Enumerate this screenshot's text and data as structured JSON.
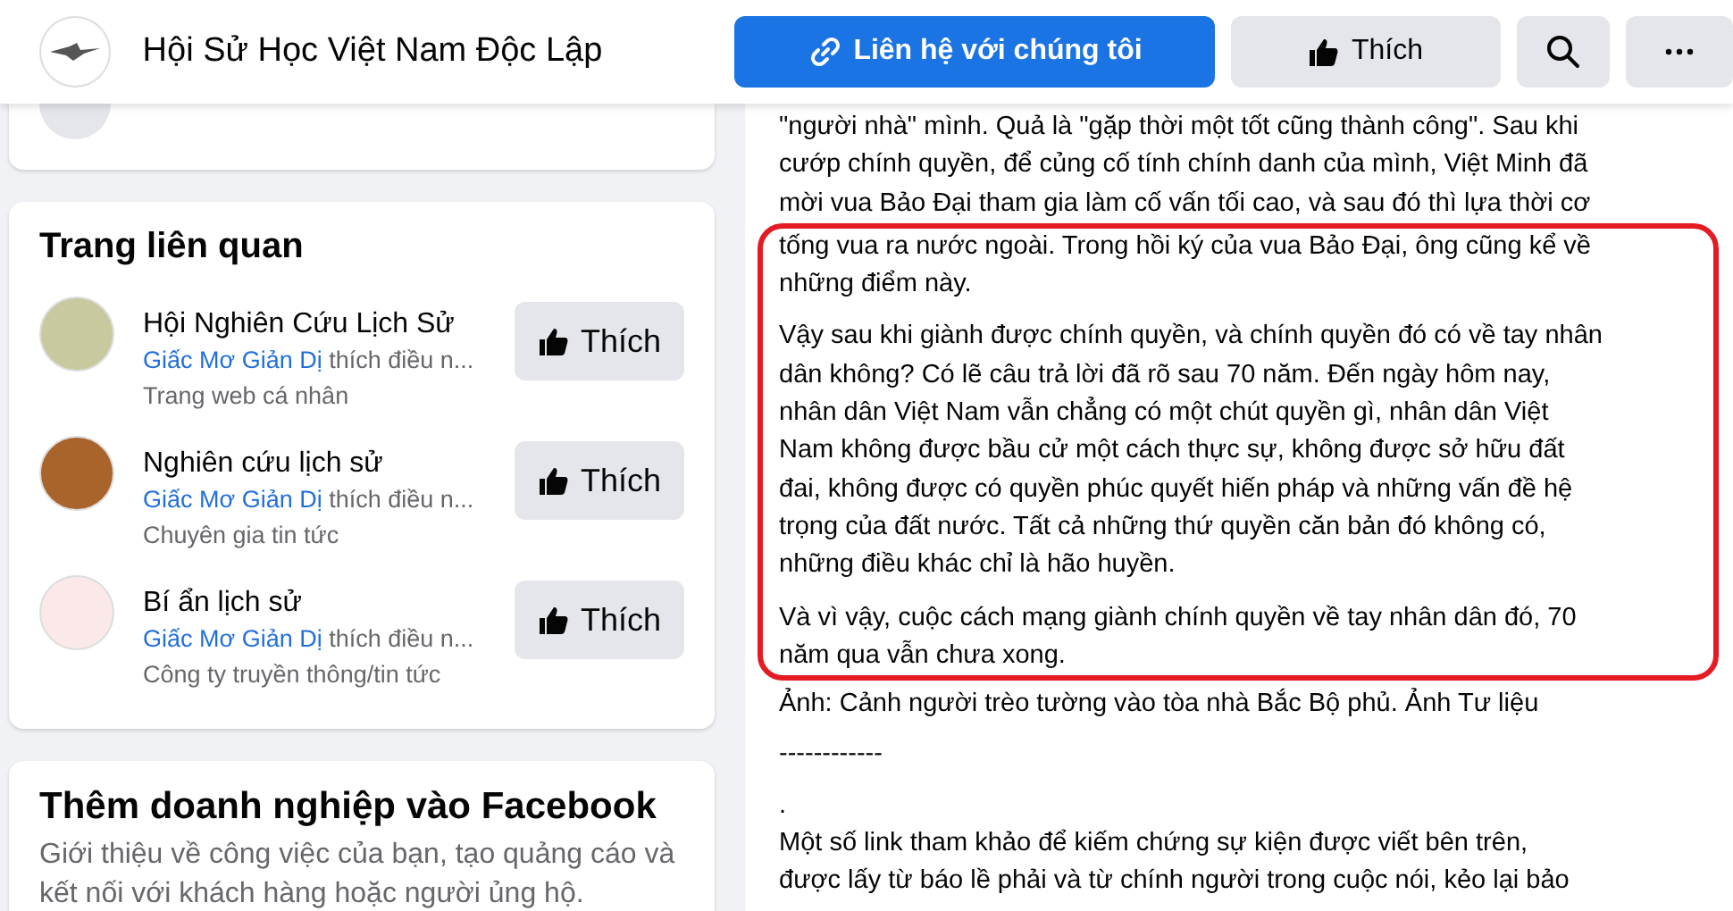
{
  "header": {
    "page_name": "Hội Sử Học Việt Nam Độc Lập",
    "contact_button": "Liên hệ với chúng tôi",
    "like_button": "Thích"
  },
  "related_pages": {
    "title": "Trang liên quan",
    "items": [
      {
        "name": "Hội Nghiên Cứu Lịch Sử",
        "liker": "Giấc Mơ Giản Dị",
        "activity": "thích điều n...",
        "category": "Trang web cá nhân",
        "button": "Thích"
      },
      {
        "name": "Nghiên cứu lịch sử",
        "liker": "Giấc Mơ Giản Dị",
        "activity": "thích điều n...",
        "category": "Chuyên gia tin tức",
        "button": "Thích"
      },
      {
        "name": "Bí ẩn lịch sử",
        "liker": "Giấc Mơ Giản Dị",
        "activity": "thích điều n...",
        "category": "Công ty truyền thông/tin tức",
        "button": "Thích"
      }
    ]
  },
  "business_card": {
    "title": "Thêm doanh nghiệp vào Facebook",
    "text": "Giới thiệu về công việc của bạn, tạo quảng cáo và kết nối với khách hàng hoặc người ủng hộ."
  },
  "post": {
    "blocks": [
      {
        "highlighted": false,
        "paragraphs": [
          {
            "lines": [
              "\"người nhà\" mình. Quả là \"gặp thời một tốt cũng thành công\". Sau khi",
              "cướp chính quyền, để củng cố tính chính danh của mình, Việt Minh đã",
              "mời vua Bảo Đại tham gia làm cố vấn tối cao, và sau đó thì lựa thời cơ"
            ]
          }
        ]
      },
      {
        "highlighted": true,
        "paragraphs": [
          {
            "lines": [
              "tống vua ra nước ngoài. Trong hồi ký của vua Bảo Đại, ông cũng kể về",
              "những điểm này."
            ]
          },
          {
            "lines": [
              "Vậy sau khi giành được chính quyền, và chính quyền đó có về tay nhân",
              "dân không? Có lẽ câu trả lời đã rõ sau 70 năm. Đến ngày hôm nay,",
              "nhân dân Việt Nam vẫn chẳng có một chút quyền gì, nhân dân Việt",
              "Nam không được bầu cử một cách thực sự, không được sở hữu đất",
              "đai, không được có quyền phúc quyết hiến pháp và những vấn đề hệ",
              "trọng của đất nước. Tất cả những thứ quyền căn bản đó không có,",
              "những điều khác chỉ là hão huyền."
            ]
          },
          {
            "lines": [
              "Và vì vậy, cuộc cách mạng giành chính quyền về tay nhân dân đó, 70",
              "năm qua vẫn chưa xong."
            ]
          }
        ]
      },
      {
        "highlighted": false,
        "paragraphs": [
          {
            "lines": [
              "Ảnh: Cảnh người trèo tường vào tòa nhà Bắc Bộ phủ. Ảnh Tư liệu"
            ]
          },
          {
            "lines": [
              "------------"
            ]
          },
          {
            "lines": [
              ".",
              "Một số link tham khảo để kiếm chứng sự kiện được viết bên trên,",
              "được lấy từ báo lề phải và từ chính người trong cuộc nói, kẻo lại bảo"
            ]
          }
        ]
      }
    ]
  }
}
